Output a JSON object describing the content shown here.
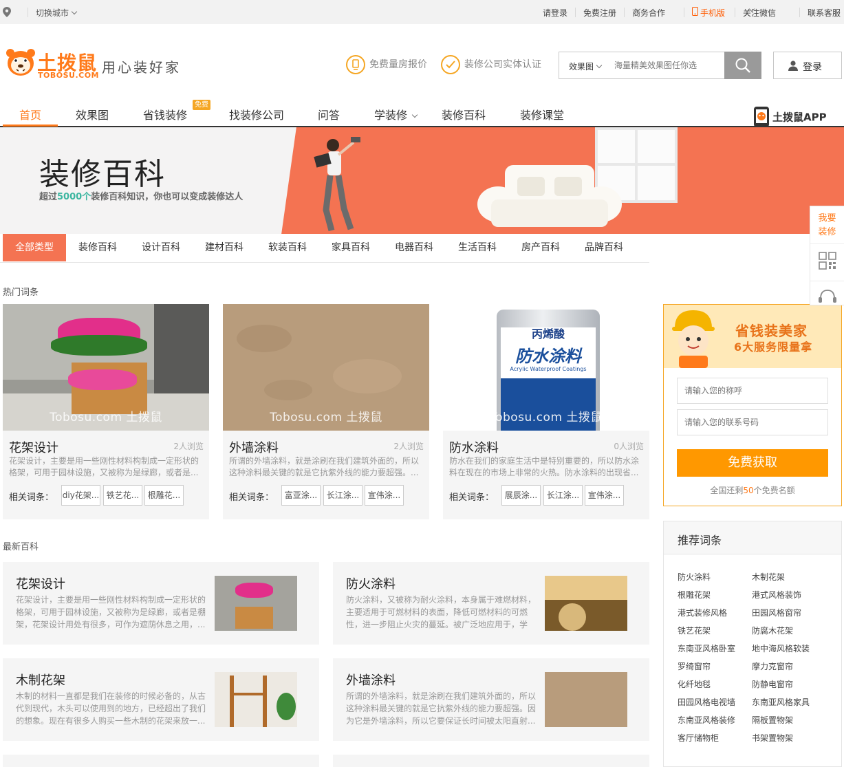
{
  "topbar": {
    "switch_city": "切换城市",
    "links": {
      "login": "请登录",
      "register": "免费注册",
      "business": "商务合作",
      "mobile": "手机版",
      "wechat": "关注微信",
      "service": "联系客服"
    }
  },
  "header": {
    "logo_text": "土拨鼠",
    "logo_sub": "TOBOSU.COM",
    "slogan": "用心装好家",
    "badge_quote": "免费量房报价",
    "badge_cert": "装修公司实体认证",
    "search_type": "效果图",
    "search_placeholder": "海量精美效果图任你选",
    "login": "登录"
  },
  "nav": {
    "items": [
      "首页",
      "效果图",
      "省钱装修",
      "找装修公司",
      "问答",
      "学装修",
      "装修百科",
      "装修课堂"
    ],
    "free_tag": "免费",
    "app": "土拨鼠APP"
  },
  "banner": {
    "title": "装修百科",
    "sub_prefix": "超过",
    "sub_highlight": "5000个",
    "sub_suffix": "装修百科知识，你也可以变成装修达人"
  },
  "categories": [
    "全部类型",
    "装修百科",
    "设计百科",
    "建材百科",
    "软装百科",
    "家具百科",
    "电器百科",
    "生活百科",
    "房产百科",
    "品牌百科"
  ],
  "hot": {
    "section_title": "热门词条",
    "related_label": "相关词条：",
    "watermark": "Tobosu.com 土拨鼠",
    "cards": [
      {
        "title": "花架设计",
        "views": "2人浏览",
        "desc": "花架设计，主要是用一些刚性材料构制成一定形状的格架，可用于园林设施，又被称为是绿廊，或者是...",
        "tags": [
          "diy花架...",
          "铁艺花...",
          "根雕花..."
        ]
      },
      {
        "title": "外墙涂料",
        "views": "2人浏览",
        "desc": "所谓的外墙涂料，就是涂刷在我们建筑外面的，所以这种涂料最关键的就是它抗紫外线的能力要超强。...",
        "tags": [
          "富亚涂...",
          "长江涂...",
          "宣伟涂..."
        ]
      },
      {
        "title": "防水涂料",
        "views": "0人浏览",
        "desc": "防水在我们的家庭生活中是特别重要的，所以防水涂料在现在的市场上非常的火热。防水涂料的出现省...",
        "tags": [
          "展辰涂...",
          "长江涂...",
          "宣伟涂..."
        ],
        "can_brand": "丙烯酸",
        "can_name": "防水涂料",
        "can_en": "Acrylic Waterproof Coatings"
      }
    ]
  },
  "latest": {
    "section_title": "最新百科",
    "cards": [
      {
        "title": "花架设计",
        "desc": "花架设计，主要是用一些刚性材料构制成一定形状的格架，可用于园林设施，又被称为是绿廊，或者是棚架，花架设计用处有很多，可作为遮荫休息之用，..."
      },
      {
        "title": "防火涂料",
        "desc": "防火涂料，又被称为耐火涂料，本身属于难燃材料，主要适用于可燃材料的表面，降低可燃材料的可燃性，进一步阻止火灾的蔓延。被广泛地应用于，学"
      },
      {
        "title": "木制花架",
        "desc": "木制的材料一直都是我们在装修的时候必备的，从古代到现代，木头可以使用到的地方，已经超出了我们的想象。现在有很多人购买一些木制的花架来放一..."
      },
      {
        "title": "外墙涂料",
        "desc": "所谓的外墙涂料，就是涂刷在我们建筑外面的，所以这种涂料最关键的就是它抗紫外线的能力要超强。因为它是外墙涂料，所以它要保证长时间被太阳直射..."
      }
    ]
  },
  "promo": {
    "title1": "省钱装美家",
    "title2": "6大服务限量拿",
    "name_placeholder": "请输入您的称呼",
    "phone_placeholder": "请输入您的联系号码",
    "submit": "免费获取",
    "remain_prefix": "全国还剩",
    "remain_num": "50",
    "remain_suffix": "个免费名额"
  },
  "recommend": {
    "title": "推荐词条",
    "left": [
      "防火涂料",
      "根雕花架",
      "港式装修风格",
      "铁艺花架",
      "东南亚风格卧室",
      "罗绮窗帘",
      "化纤地毯",
      "田园风格电视墙",
      "东南亚风格装修",
      "客厅储物柜"
    ],
    "right": [
      "木制花架",
      "港式风格装饰",
      "田园风格窗帘",
      "防腐木花架",
      "地中海风格软装",
      "摩力克窗帘",
      "防静电窗帘",
      "东南亚风格家具",
      "隔板置物架",
      "书架置物架"
    ]
  },
  "sidetool": {
    "cta_line1": "我要",
    "cta_line2": "装修"
  },
  "colors": {
    "accent": "#ff7a1a",
    "banner_orange": "#f47352",
    "submit": "#ff9800"
  }
}
